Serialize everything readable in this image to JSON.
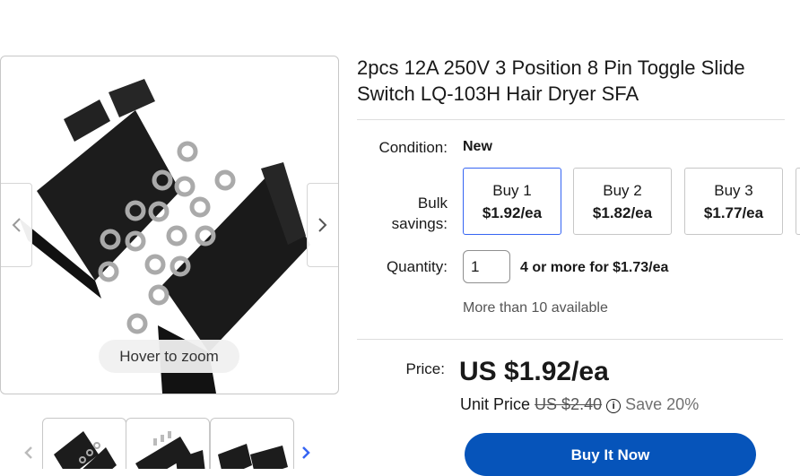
{
  "gallery": {
    "zoom_label": "Hover to zoom",
    "prev_icon": "chevron-left-icon",
    "next_icon": "chevron-right-icon",
    "thumb_prev_icon": "chevron-left-icon",
    "thumb_next_icon": "chevron-right-icon",
    "thumbnail_count_visible": 3
  },
  "listing": {
    "title": "2pcs 12A 250V 3 Position 8 Pin Toggle Slide Switch LQ-103H Hair Dryer SFA",
    "condition_label": "Condition:",
    "condition_value": "New",
    "bulk_label_line1": "Bulk",
    "bulk_label_line2": "savings:",
    "bulk_options": [
      {
        "label": "Buy 1",
        "price": "$1.92/ea",
        "selected": true
      },
      {
        "label": "Buy 2",
        "price": "$1.82/ea",
        "selected": false
      },
      {
        "label": "Buy 3",
        "price": "$1.77/ea",
        "selected": false
      }
    ],
    "quantity_label": "Quantity:",
    "quantity_value": "1",
    "quantity_note": "4 or more for $1.73/ea",
    "availability": "More than 10 available",
    "price_label": "Price:",
    "price": "US $1.92/ea",
    "unit_price_label": "Unit Price",
    "original_price": "US $2.40",
    "info_icon": "info-icon",
    "save_text": "Save 20%",
    "buy_now_label": "Buy It Now"
  },
  "colors": {
    "accent_blue": "#3665f3",
    "buy_button": "#0654ba",
    "border": "#c7c7c7"
  }
}
